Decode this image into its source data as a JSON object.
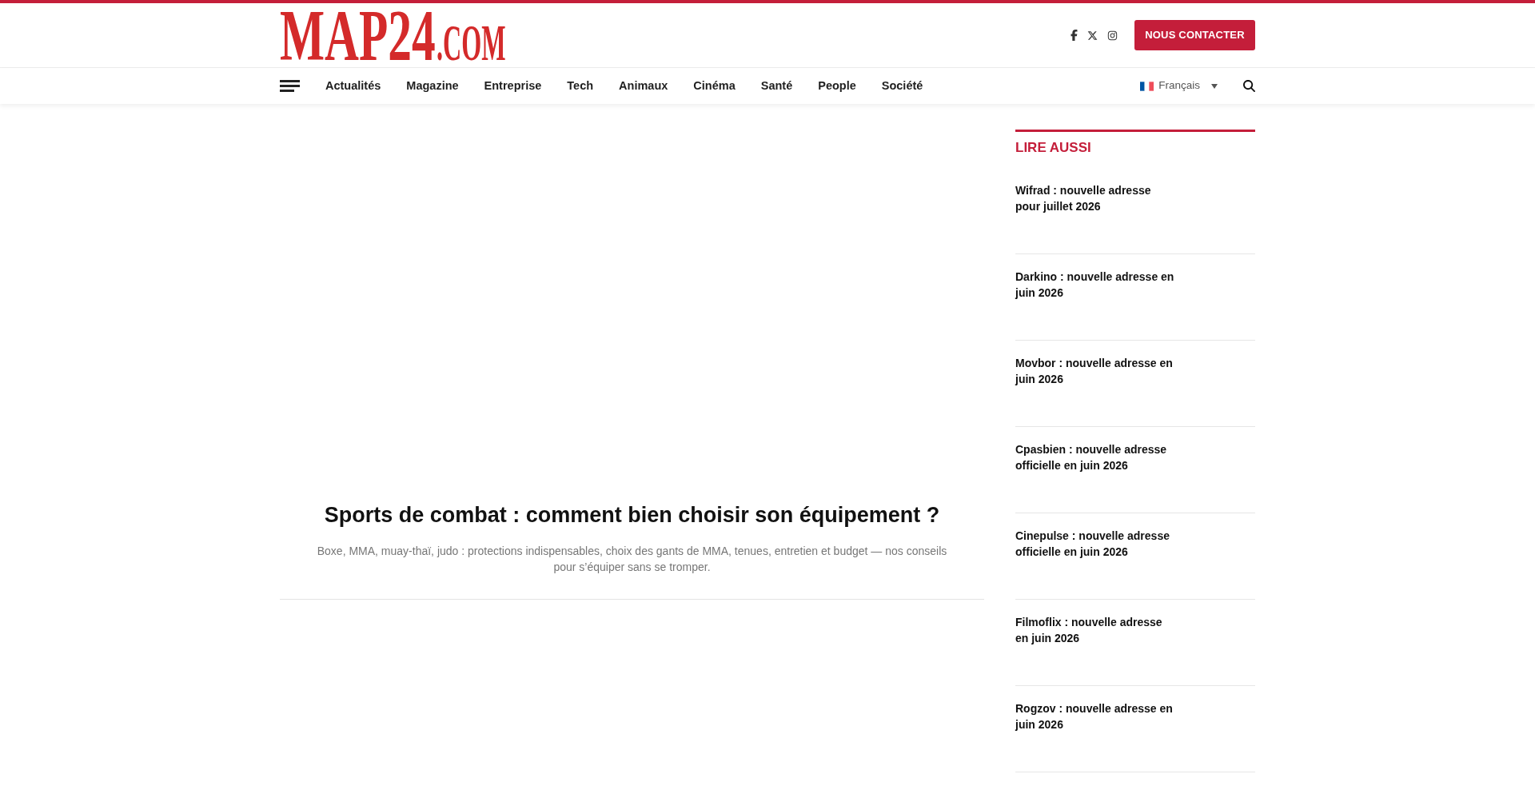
{
  "header": {
    "logo": {
      "name": "MAP24",
      "suffix": ".COM"
    },
    "social_links": [
      {
        "kind": "facebook"
      },
      {
        "kind": "x"
      },
      {
        "kind": "instagram"
      }
    ],
    "contact_button": "NOUS CONTACTER"
  },
  "nav": {
    "items": [
      "Actualités",
      "Magazine",
      "Entreprise",
      "Tech",
      "Animaux",
      "Cinéma",
      "Santé",
      "People",
      "Société"
    ],
    "language": "Français"
  },
  "article": {
    "title": "Sports de combat : comment bien choisir son équipement ?",
    "excerpt": "Boxe, MMA, muay-thaï, judo : protections indispensables, choix des gants de MMA, tenues, entretien et budget — nos conseils pour s’équiper sans se tromper."
  },
  "sidebar": {
    "heading": "LIRE AUSSI",
    "items": [
      "Wifrad : nouvelle adresse pour juillet 2026",
      "Darkino : nouvelle adresse en juin 2026",
      "Movbor : nouvelle adresse en juin 2026",
      "Cpasbien : nouvelle adresse officielle en juin 2026",
      "Cinepulse : nouvelle adresse officielle en juin 2026",
      "Filmoflix : nouvelle adresse en juin 2026",
      "Rogzov : nouvelle adresse en juin 2026"
    ]
  }
}
